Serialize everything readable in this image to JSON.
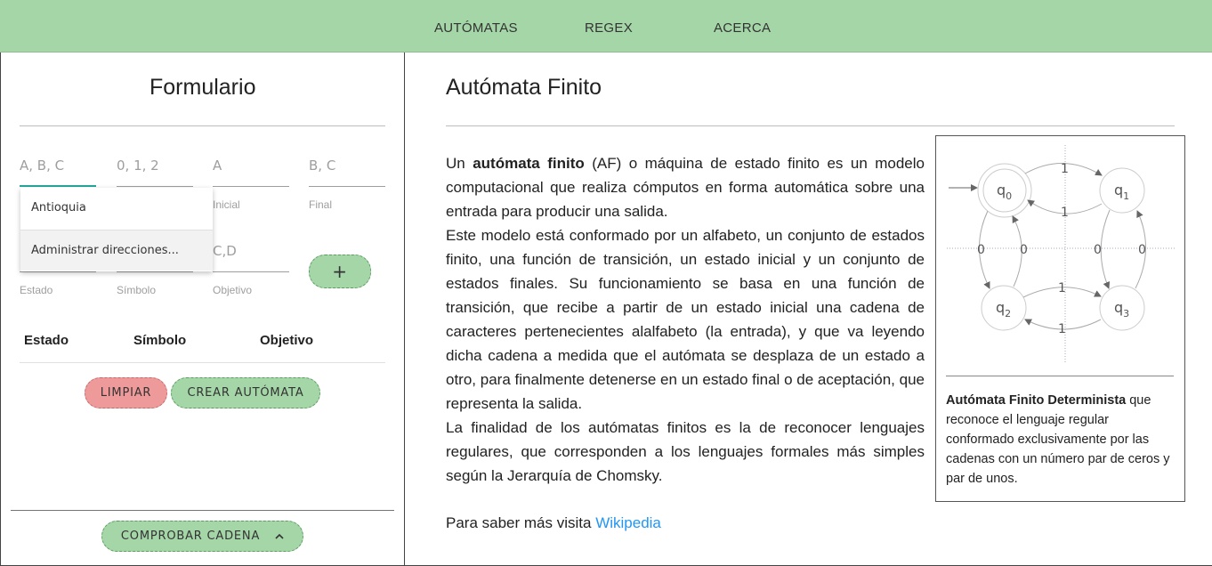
{
  "nav": {
    "items": [
      "AUTÓMATAS",
      "REGEX",
      "ACERCA"
    ]
  },
  "form": {
    "title": "Formulario",
    "alphabet_placeholder": "A, B, C",
    "symbols_placeholder": "0, 1, 2",
    "initial_placeholder": "A",
    "initial_helper": "Inicial",
    "final_placeholder": "B, C",
    "final_helper": "Final",
    "state_helper": "Estado",
    "symbol_helper": "Símbolo",
    "target_placeholder": "C,D",
    "target_helper": "Objetivo",
    "add_button": "+",
    "autocomplete": [
      "Antioquia",
      "Administrar direcciones..."
    ],
    "table_headers": [
      "Estado",
      "Símbolo",
      "Objetivo"
    ],
    "clear_button": "LIMPIAR",
    "create_button": "CREAR AUTÓMATA",
    "check_button": "COMPROBAR CADENA",
    "check_icon": "chevron-up-icon"
  },
  "article": {
    "title": "Autómata Finito",
    "intro_lead": "Un ",
    "intro_bold": "autómata finito",
    "intro_rest": " (AF) o máquina de estado finito es un modelo computacional que realiza cómputos en forma automática sobre una entrada para producir una salida.",
    "paragraph2": "Este modelo está conformado por un alfabeto, un conjunto de estados finito, una función de transición, un estado inicial y un conjunto de estados finales. Su funcionamiento se basa en una función de transición, que recibe a partir de un estado inicial una cadena de caracteres pertenecientes alalfabeto (la entrada), y que va leyendo dicha cadena a medida que el autómata se desplaza de un estado a otro, para finalmente detenerse en un estado final o de aceptación, que representa la salida.",
    "paragraph3": "La finalidad de los autómatas finitos es la de reconocer lenguajes regulares, que corresponden a los lenguajes formales más simples según la Jerarquía de Chomsky.",
    "more_text": "Para saber más visita ",
    "more_link": "Wikipedia",
    "link_color": "#2196f3"
  },
  "figure": {
    "states": [
      "q",
      "q",
      "q",
      "q"
    ],
    "state_subscripts": [
      "0",
      "1",
      "2",
      "3"
    ],
    "edge_labels": [
      "1",
      "1",
      "0",
      "0",
      "0",
      "0",
      "1",
      "1"
    ],
    "caption_bold": "Autómata Finito Determinista",
    "caption_rest": " que reconoce el lenguaje regular conformado exclusivamente por las cadenas con un número par de ceros y par de unos."
  },
  "colors": {
    "navbar": "#a5d6a7",
    "button_green": "#a5d6a7",
    "button_red": "#ef9a9a"
  }
}
